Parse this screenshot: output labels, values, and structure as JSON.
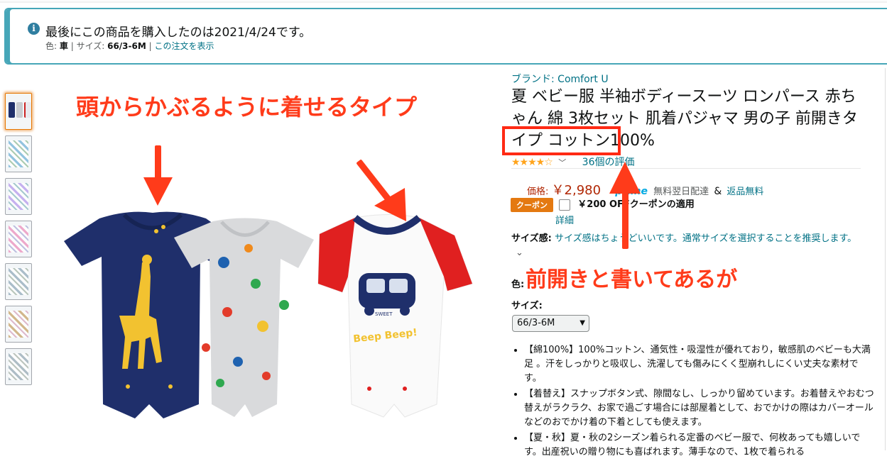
{
  "notice": {
    "message": "最後にこの商品を購入したのは2021/4/24です。",
    "color_label": "色:",
    "color_value": "車",
    "size_label": "サイズ:",
    "size_value": "66/3-6M",
    "view_order_link": "この注文を表示",
    "info_icon": "i"
  },
  "annotations": {
    "caption_top": "頭からかぶるように着せるタイプ",
    "caption_right": "前開きと書いてあるが",
    "highlight_color": "#ff2a14"
  },
  "product": {
    "brand": "ブランド: Comfort U",
    "title": "夏 ベビー服 半袖ボディースーツ ロンパース 赤ちゃん 綿 3枚セット 肌着パジャマ 男の子 前開きタイプ コットン100%",
    "stars": "★★★★☆",
    "rating_chevron": "﹀",
    "review_count": "36個の評価",
    "price_label": "価格:",
    "price": "￥2,980",
    "prime": "prime",
    "delivery": "無料翌日配達",
    "amp": "&",
    "returns": "返品無料",
    "coupon_badge": "クーポン",
    "coupon_text": "￥200 OFFクーポンの適用",
    "coupon_detail": "詳細",
    "fit_label": "サイズ感:",
    "fit_text": "サイズ感はちょうどいいです。通常サイズを選択することを推奨します。",
    "fit_chevron": "⌄",
    "color_label": "色:",
    "size_label": "サイズ:",
    "size_selected": "66/3-6M",
    "bullets": [
      "【綿100%】100%コットン、通気性・吸湿性が優れており，敏感肌のベビーも大満足 。汗をしっかりと吸収し、洗濯しても傷みにくく型崩れしにくい丈夫な素材です。",
      "【着替え】スナップボタン式、隙間なし、しっかり留めています。お着替えやおむつ替えがラクラク、お家で過ごす場合には部屋着として、おでかけの際はカバーオールなどのおでかけ着の下着としても使えます。",
      "【夏・秋】夏・秋の2シーズン着られる定番のベビー服で、何枚あっても嬉しいです。出産祝いの贈り物にも喜ばれます。薄手なので、1枚で着られる"
    ]
  },
  "image": {
    "bus_text": "SWEET",
    "beep_text": "Beep Beep!"
  },
  "colors": {
    "accent": "#46a6b8",
    "link": "#007185",
    "price": "#b12704",
    "annotation": "#ff3b1a",
    "navy": "#1f2f6b",
    "red_sleeve": "#e02020",
    "giraffe": "#f2c230"
  }
}
